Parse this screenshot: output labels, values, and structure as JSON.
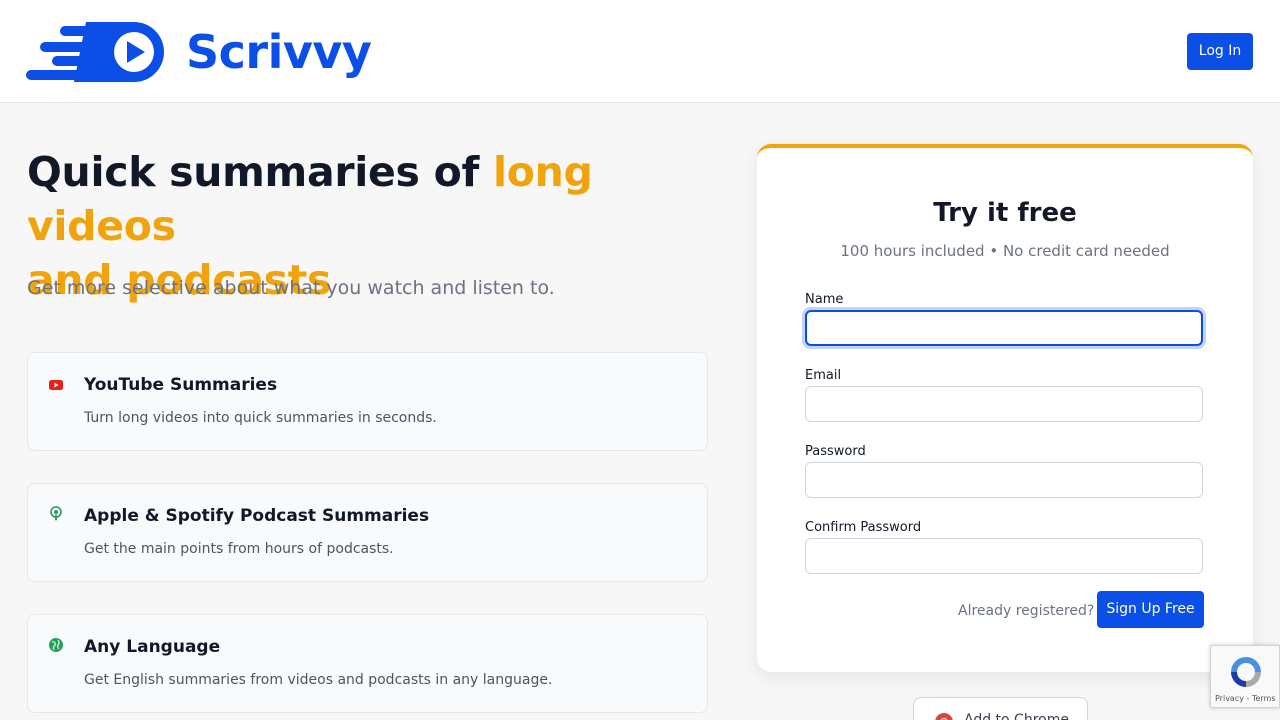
{
  "header": {
    "brand": "Scrivvy",
    "login_label": "Log In"
  },
  "hero": {
    "title_part1": "Quick summaries of ",
    "title_accent_line1": "long videos",
    "title_accent_line2": "and podcasts",
    "subtitle": "Get more selective about what you watch and listen to."
  },
  "features": [
    {
      "icon": "youtube-icon",
      "title": "YouTube Summaries",
      "desc": "Turn long videos into quick summaries in seconds."
    },
    {
      "icon": "podcast-icon",
      "title": "Apple & Spotify Podcast Summaries",
      "desc": "Get the main points from hours of podcasts."
    },
    {
      "icon": "globe-icon",
      "title": "Any Language",
      "desc": "Get English summaries from videos and podcasts in any language."
    }
  ],
  "signup": {
    "title": "Try it free",
    "subtitle": "100 hours included • No credit card needed",
    "fields": [
      {
        "label": "Name",
        "value": ""
      },
      {
        "label": "Email",
        "value": ""
      },
      {
        "label": "Password",
        "value": ""
      },
      {
        "label": "Confirm Password",
        "value": ""
      }
    ],
    "already_registered": "Already registered?",
    "submit_label": "Sign Up Free"
  },
  "chrome_button": {
    "label": "Add to Chrome"
  },
  "recaptcha": {
    "links": "Privacy - Terms"
  },
  "colors": {
    "brand_blue": "#0b4fe6",
    "accent_orange": "#f0a30a",
    "youtube_red": "#e62117",
    "green": "#22a05a"
  }
}
